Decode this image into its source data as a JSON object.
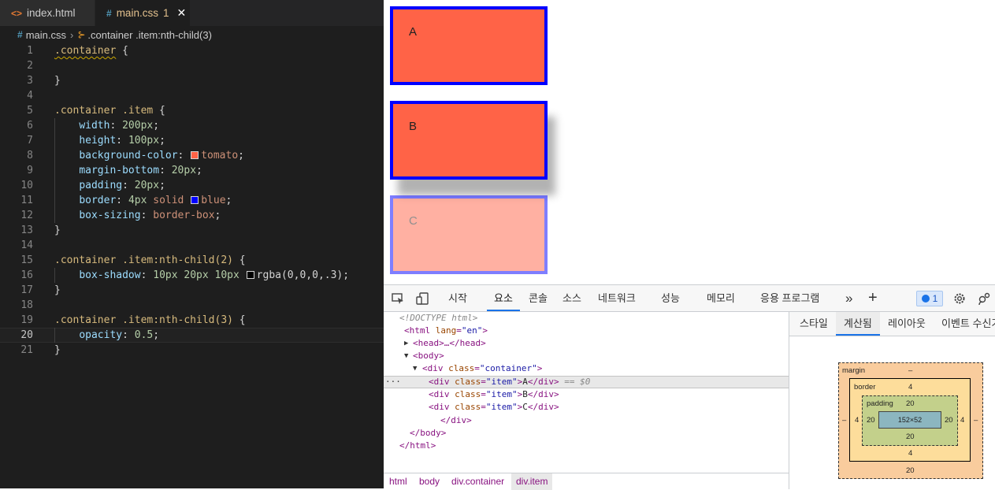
{
  "editor": {
    "tabs": [
      {
        "icon": "<>",
        "label": "index.html"
      },
      {
        "icon": "#",
        "label": "main.css",
        "modified": "1",
        "close": "✕"
      }
    ],
    "breadcrumb": {
      "file": "main.css",
      "symbol": ".container .item:nth-child(3)"
    },
    "line_numbers": [
      "1",
      "2",
      "3",
      "4",
      "5",
      "6",
      "7",
      "8",
      "9",
      "10",
      "11",
      "12",
      "13",
      "14",
      "15",
      "16",
      "17",
      "18",
      "19",
      "20",
      "21"
    ],
    "code": {
      "l1_sel": ".container",
      "l1_brace": " {",
      "close": "}",
      "l5_sel": ".container .item",
      "open": " {",
      "l6_prop": "width",
      "l6_val": "200px",
      "l7_prop": "height",
      "l7_val": "100px",
      "l8_prop": "background-color",
      "l8_val": "tomato",
      "l9_prop": "margin-bottom",
      "l9_val": "20px",
      "l10_prop": "padding",
      "l10_val": "20px",
      "l11_prop": "border",
      "l11_num": "4px",
      "l11_style": "solid",
      "l11_color": "blue",
      "l12_prop": "box-sizing",
      "l12_val": "border-box",
      "l15_sel": ".container .item:nth-child(2)",
      "l16_prop": "box-shadow",
      "l16_v1": "10px",
      "l16_v2": "20px",
      "l16_v3": "10px",
      "l16_func": "rgba(0,0,0,.3)",
      "l19_sel": ".container .item:nth-child(3)",
      "l20_prop": "opacity",
      "l20_val": "0.5"
    },
    "colors": {
      "tomato": "#ff6347",
      "blue": "#0000ff",
      "shadow": "rgba(0,0,0,.3)"
    }
  },
  "preview": {
    "items": [
      "A",
      "B",
      "C"
    ]
  },
  "devtools": {
    "tabs": [
      "시작",
      "요소",
      "콘솔",
      "소스",
      "네트워크",
      "성능",
      "메모리",
      "응용 프로그램"
    ],
    "active_tab": "요소",
    "more": "»",
    "add": "+",
    "issues_count": "1",
    "dom": {
      "doctype": "<!DOCTYPE html>",
      "html_open": "<html",
      "lang_attr": "lang",
      "lang_val": "\"en\"",
      "head": "<head>…</head>",
      "body_open": "<body>",
      "div_open": "<div",
      "class_attr": "class",
      "container_val": "\"container\"",
      "item_val": "\"item\"",
      "item_a": "A",
      "item_b": "B",
      "item_c": "C",
      "div_close": "</div>",
      "body_close": "</body>",
      "html_close": "</html>",
      "selected_marker": "== $0",
      "dots": "···"
    },
    "crumbs": [
      "html",
      "body",
      "div.container",
      "div.item"
    ],
    "side_tabs": [
      "스타일",
      "계산됨",
      "레이아웃",
      "이벤트 수신기"
    ],
    "active_side_tab": "계산됨",
    "box_model": {
      "margin_label": "margin",
      "margin_top": "–",
      "margin_left": "–",
      "margin_right": "–",
      "margin_bottom": "20",
      "border_label": "border",
      "border_top": "4",
      "border_left": "4",
      "border_right": "4",
      "border_bottom": "4",
      "padding_label": "padding",
      "padding_top": "20",
      "padding_left": "20",
      "padding_right": "20",
      "padding_bottom": "20",
      "content": "152×52"
    }
  }
}
